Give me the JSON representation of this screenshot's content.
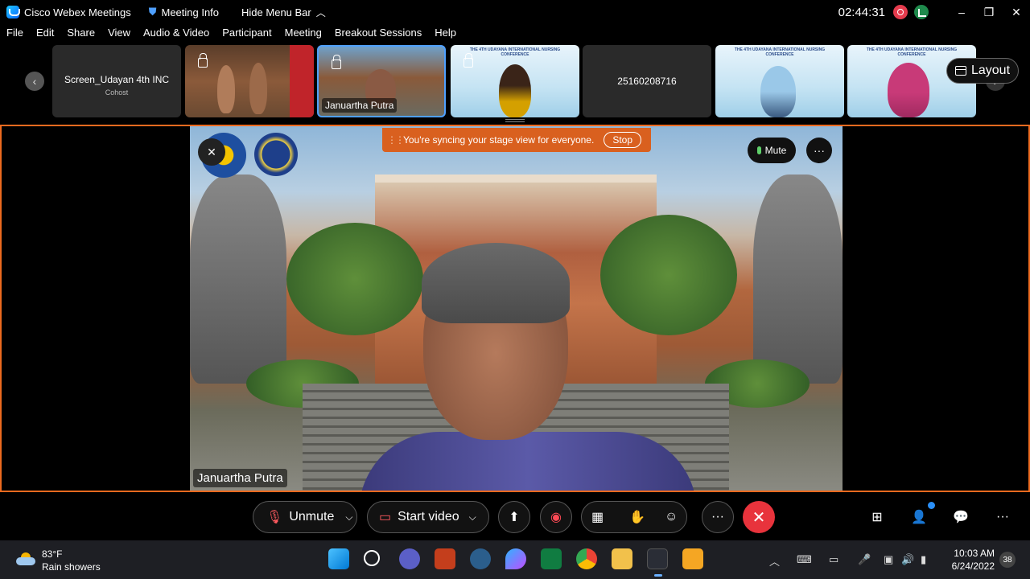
{
  "titlebar": {
    "app_name": "Cisco Webex Meetings",
    "meeting_info": "Meeting Info",
    "hide_menu": "Hide Menu Bar",
    "clock": "02:44:31",
    "minimize": "–",
    "restore": "❐",
    "close": "✕"
  },
  "menu": {
    "file": "File",
    "edit": "Edit",
    "share": "Share",
    "view": "View",
    "audio_video": "Audio & Video",
    "participant": "Participant",
    "meeting": "Meeting",
    "breakout": "Breakout Sessions",
    "help": "Help"
  },
  "filmstrip": {
    "prev": "‹",
    "next": "›",
    "tile1_name": "Screen_Udayan 4th INC",
    "tile1_role": "Cohost",
    "tile3_name": "Januartha Putra",
    "tile5_name": "25160208716",
    "banner_text": "THE 4TH UDAYANA INTERNATIONAL NURSING CONFERENCE",
    "layout_label": "Layout"
  },
  "stage": {
    "sync_message": "You're syncing your stage view for everyone.",
    "stop_label": "Stop",
    "mute_label": "Mute",
    "more_label": "···",
    "speaker_name": "Januartha Putra"
  },
  "controls": {
    "unmute_label": "Unmute",
    "start_video_label": "Start video",
    "chevron": "⌵",
    "more": "···",
    "end": "✕",
    "more_right": "···"
  },
  "taskbar": {
    "temperature": "83°F",
    "weather": "Rain showers",
    "time": "10:03 AM",
    "date": "6/24/2022",
    "notifications": "38"
  },
  "colors": {
    "stage_border": "#ec6a1f",
    "sync_bar": "#d9601f",
    "end_button": "#e8333c",
    "active_tile": "#4fa0ff"
  }
}
